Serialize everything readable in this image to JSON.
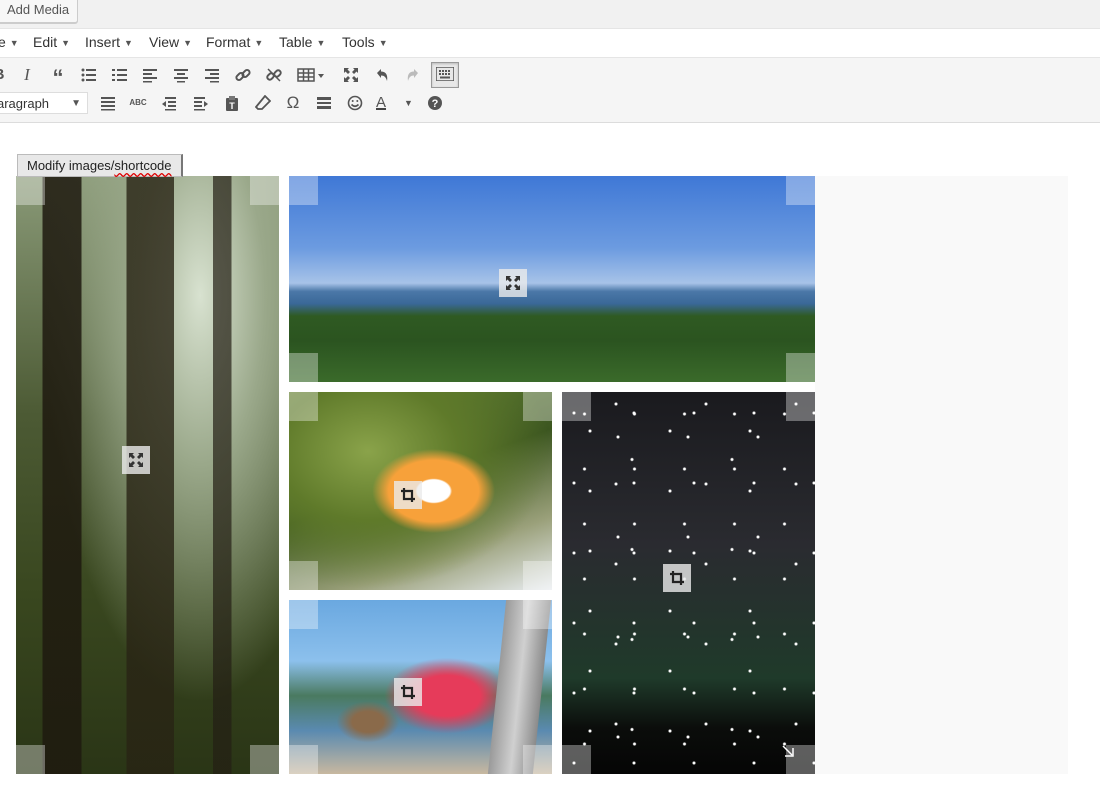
{
  "topbar": {
    "add_media_label": "Add Media"
  },
  "menubar": {
    "items": [
      {
        "label": "e"
      },
      {
        "label": "Edit"
      },
      {
        "label": "Insert"
      },
      {
        "label": "View"
      },
      {
        "label": "Format"
      },
      {
        "label": "Table"
      },
      {
        "label": "Tools"
      }
    ]
  },
  "toolbar": {
    "row1_icons": [
      "bold-icon",
      "italic-icon",
      "blockquote-icon",
      "bullet-list-icon",
      "numbered-list-icon",
      "align-left-icon",
      "align-center-icon",
      "align-right-icon",
      "link-icon",
      "unlink-icon",
      "table-icon",
      "fullscreen-icon",
      "undo-icon",
      "redo-icon",
      "toolbar-toggle-icon"
    ],
    "row2_icons": [
      "justify-icon",
      "spellcheck-icon",
      "outdent-icon",
      "indent-icon",
      "paste-text-icon",
      "clear-format-icon",
      "omega-icon",
      "horizontal-rule-icon",
      "emoji-icon",
      "text-color-icon",
      "help-icon"
    ],
    "format_select_value": "aragraph",
    "spellcheck_text": "ABC",
    "text_color_letter": "A"
  },
  "editor": {
    "modify_button_prefix": "Modify images/",
    "modify_button_misspelled": "shortcode",
    "gallery": {
      "tiles": [
        {
          "name": "forest",
          "control_icon": "shrink-icon"
        },
        {
          "name": "landscape",
          "control_icon": "shrink-icon"
        },
        {
          "name": "nudibranch",
          "control_icon": "crop-icon"
        },
        {
          "name": "night-sky",
          "control_icon": "crop-icon"
        },
        {
          "name": "hummingbird",
          "control_icon": "crop-icon"
        }
      ]
    }
  }
}
